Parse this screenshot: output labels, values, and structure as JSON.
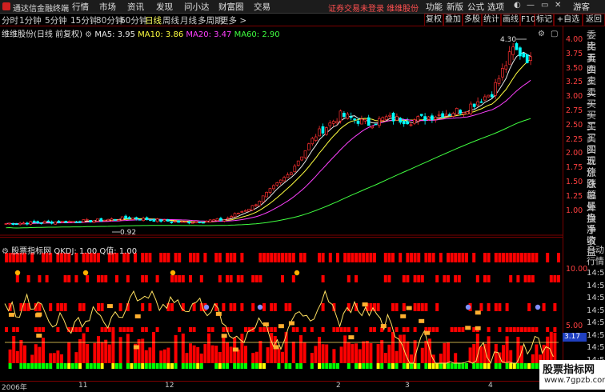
{
  "app": {
    "title": "通达信金融终端"
  },
  "menu": {
    "items": [
      "行情",
      "市场",
      "资讯",
      "发现",
      "问小达",
      "财富圈",
      "交易"
    ],
    "login_notice": "证券交易未登录  维维股份",
    "right_items": [
      "功能",
      "新版",
      "公式",
      "选项"
    ],
    "guest": "游客"
  },
  "periods": {
    "items": [
      "分时",
      "1分钟",
      "5分钟",
      "15分钟",
      "30分钟",
      "60分钟",
      "日线",
      "周线",
      "月线",
      "多周期",
      "更多 >"
    ],
    "active": "日线"
  },
  "toolbar": {
    "buttons": [
      "复权",
      "叠加",
      "多股",
      "统计",
      "画线",
      "F10",
      "标记",
      "+自选",
      "返回"
    ]
  },
  "main": {
    "stock_label": "维维股份(日线 前复权)",
    "ma": [
      {
        "label": "MA5: 3.95",
        "color": "#e8e8e8"
      },
      {
        "label": "MA10: 3.86",
        "color": "#ffff40"
      },
      {
        "label": "MA20: 3.47",
        "color": "#ff40ff"
      },
      {
        "label": "MA60: 2.90",
        "color": "#40ff40"
      }
    ],
    "high_label": "4.30",
    "low_label": "0.92",
    "price_scale": [
      "4.00",
      "3.75",
      "3.50",
      "3.25",
      "3.00",
      "2.75",
      "2.50",
      "2.25",
      "2.00",
      "1.75",
      "1.50",
      "1.25",
      "1.00"
    ]
  },
  "indicator": {
    "label": "股票指标网  QKDJ: 1.00  Q值: 1.00",
    "scale": [
      "10.00",
      "5.00"
    ],
    "current_value": "3.17"
  },
  "xaxis": {
    "labels": [
      "2006年",
      "11",
      "12",
      "2",
      "3",
      "4"
    ]
  },
  "right_panel": {
    "tabs": [
      "委比",
      "卖五",
      "卖四",
      "卖三",
      "卖二",
      "卖一",
      "买一",
      "买二",
      "买三",
      "买四",
      "买五",
      "现价",
      "涨跌",
      "涨幅",
      "总量",
      "外盘",
      "换手",
      "净资",
      "收益"
    ],
    "section": [
      "自动",
      "行情"
    ],
    "times": [
      "14:5",
      "14:5",
      "14:5",
      "14:5",
      "14:5",
      "14:5",
      "14:5",
      "14:5",
      "14:5"
    ]
  },
  "watermark": {
    "line1": "股票指标网",
    "line2": "www.7gpzb.com"
  },
  "colors": {
    "up": "#ff3030",
    "down": "#00ffff",
    "ma5": "#e8e8e8",
    "ma10": "#ffff40",
    "ma20": "#ff40ff",
    "ma60": "#40ff40",
    "kdj": "#ffe060",
    "signal": "#ffb030",
    "accent_red": "#ff0000",
    "green_bar": "#00ff00"
  }
}
